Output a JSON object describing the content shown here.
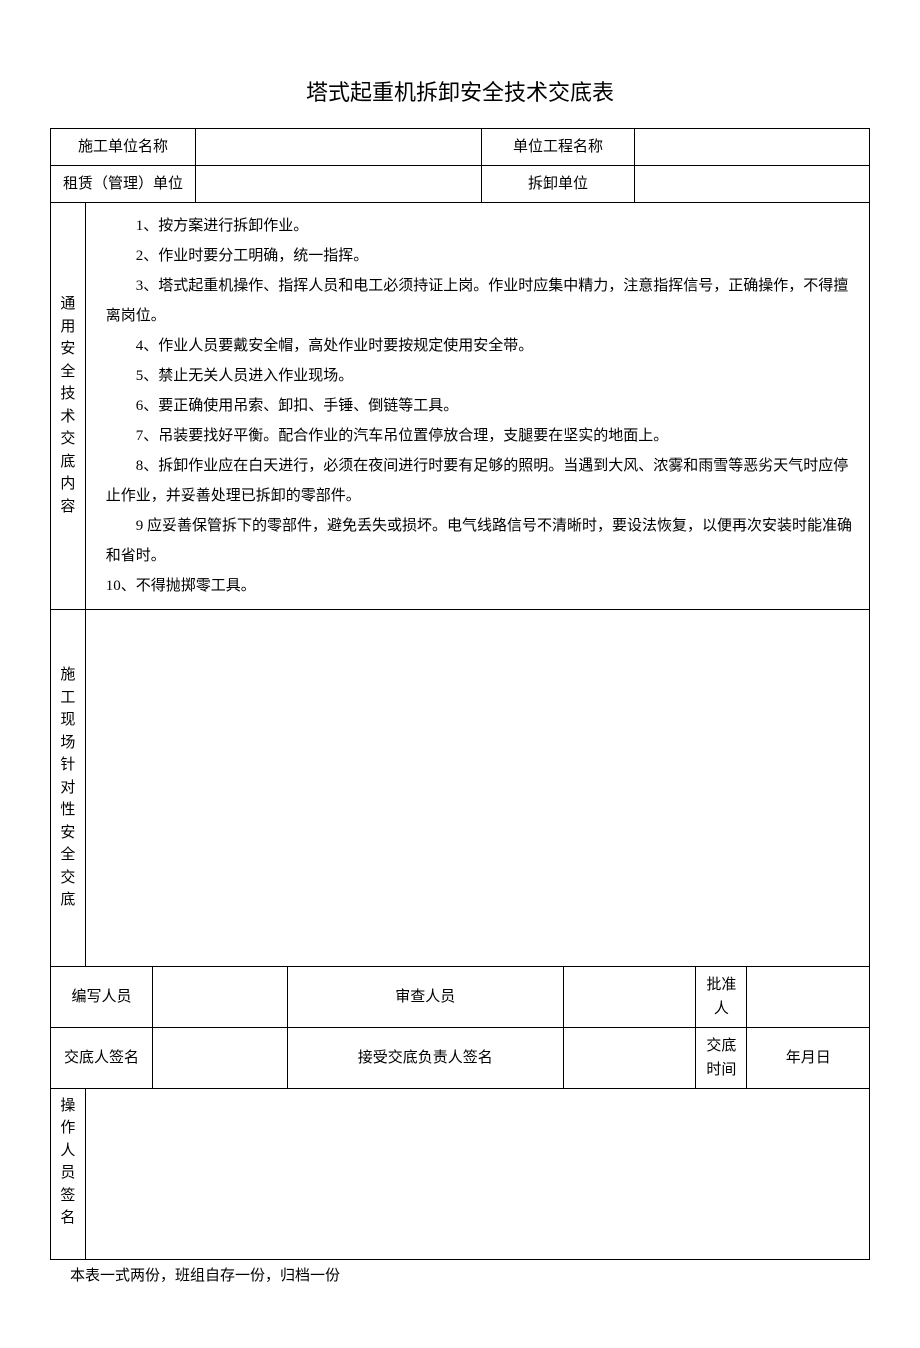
{
  "title": "塔式起重机拆卸安全技术交底表",
  "row1": {
    "label1": "施工单位名称",
    "value1": "",
    "label2": "单位工程名称",
    "value2": ""
  },
  "row2": {
    "label1": "租赁（管理）单位",
    "value1": "",
    "label2": "拆卸单位",
    "value2": ""
  },
  "section1": {
    "label": "通用安全技术交底内容",
    "lines": {
      "l1": "1、按方案进行拆卸作业。",
      "l2": "2、作业时要分工明确，统一指挥。",
      "l3": "3、塔式起重机操作、指挥人员和电工必须持证上岗。作业时应集中精力，注意指挥信号，正确操作，不得擅离岗位。",
      "l4": "4、作业人员要戴安全帽，高处作业时要按规定使用安全带。",
      "l5": "5、禁止无关人员进入作业现场。",
      "l6": "6、要正确使用吊索、卸扣、手锤、倒链等工具。",
      "l7": "7、吊装要找好平衡。配合作业的汽车吊位置停放合理，支腿要在坚实的地面上。",
      "l8": "8、拆卸作业应在白天进行，必须在夜间进行时要有足够的照明。当遇到大风、浓雾和雨雪等恶劣天气时应停止作业，并妥善处理已拆卸的零部件。",
      "l9": "9 应妥善保管拆下的零部件，避免丢失或损坏。电气线路信号不清晰时，要设法恢复，以便再次安装时能准确和省时。",
      "l10": "10、不得抛掷零工具。"
    }
  },
  "section2": {
    "label": "施工现场针对性安全交底"
  },
  "row3": {
    "label1": "编写人员",
    "value1": "",
    "label2": "审查人员",
    "value2": "",
    "label3": "批准人",
    "value3": ""
  },
  "row4": {
    "label1": "交底人签名",
    "value1": "",
    "label2": "接受交底负责人签名",
    "value2": "",
    "label3": "交底时间",
    "value3": "年月日"
  },
  "section3": {
    "label": "操作人员签名"
  },
  "footer": "本表一式两份，班组自存一份，归档一份"
}
